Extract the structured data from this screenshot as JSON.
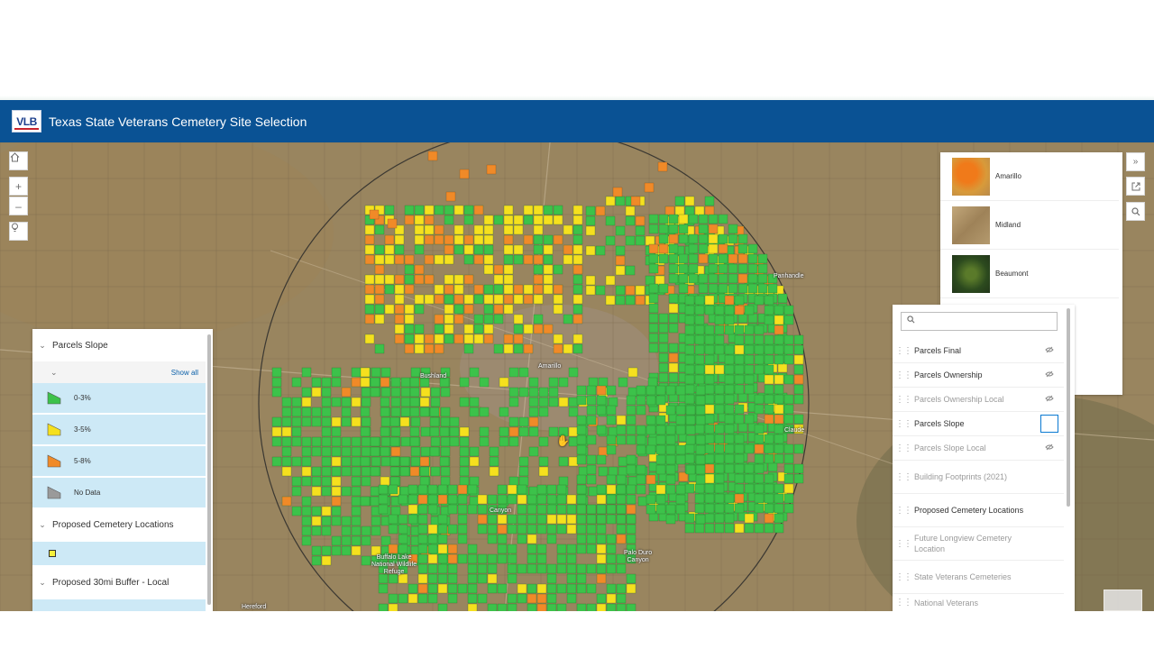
{
  "header": {
    "logo_text": "VLB",
    "title": "Texas State Veterans Cemetery Site Selection"
  },
  "map_controls": {
    "home_icon": "home-icon",
    "zoom_in": "+",
    "zoom_out": "–",
    "locate_icon": "lightbulb-icon"
  },
  "map_labels": {
    "amarillo": "Amarillo",
    "bushland": "Bushland",
    "canyon": "Canyon",
    "panhandle": "Panhandle",
    "claude": "Claude",
    "buffalo_lake": "Buffalo Lake\nNational Wildlife\nRefuge",
    "palo_duro": "Palo Duro\nCanyon",
    "hereford": "Hereford"
  },
  "legend": {
    "group1_title": "Parcels Slope",
    "show_all": "Show all",
    "items": [
      {
        "label": "0-3%",
        "color": "#3cc24a"
      },
      {
        "label": "3-5%",
        "color": "#f5e01e"
      },
      {
        "label": "5-8%",
        "color": "#f08a28"
      },
      {
        "label": "No Data",
        "color": "#9a9a9a"
      }
    ],
    "group2_title": "Proposed Cemetery Locations",
    "group2_color": "#f5f03c",
    "group3_title": "Proposed 30mi Buffer - Local"
  },
  "gallery": {
    "items": [
      {
        "label": "Amarillo",
        "color": "#e08a2a"
      },
      {
        "label": "Midland",
        "color": "#b59a6a"
      },
      {
        "label": "Beaumont",
        "color": "#3f5a2a"
      }
    ]
  },
  "side_buttons": {
    "expand": "»",
    "share_icon": "share-icon",
    "search_icon": "search-icon"
  },
  "layer_list": {
    "search_placeholder": "",
    "layers": [
      {
        "name": "Parcels Final",
        "visible": true,
        "eye": true
      },
      {
        "name": "Parcels Ownership",
        "visible": true,
        "eye": true
      },
      {
        "name": "Parcels Ownership Local",
        "visible": false,
        "eye": true
      },
      {
        "name": "Parcels Slope",
        "visible": true,
        "eye": false,
        "checkbox": true
      },
      {
        "name": "Parcels Slope Local",
        "visible": false,
        "eye": true
      },
      {
        "name": "Building Footprints (2021)",
        "visible": false,
        "eye": false
      },
      {
        "name": "Proposed Cemetery Locations",
        "visible": true,
        "eye": false
      },
      {
        "name": "Future Longview Cemetery Location",
        "visible": false,
        "eye": false
      },
      {
        "name": "State Veterans Cemeteries",
        "visible": false,
        "eye": false
      },
      {
        "name": "National Veterans",
        "visible": false,
        "eye": false
      }
    ]
  },
  "colors": {
    "header_bg": "#0a5294",
    "slope_green": "#3cc24a",
    "slope_yellow": "#f5e01e",
    "slope_orange": "#f08a28"
  }
}
